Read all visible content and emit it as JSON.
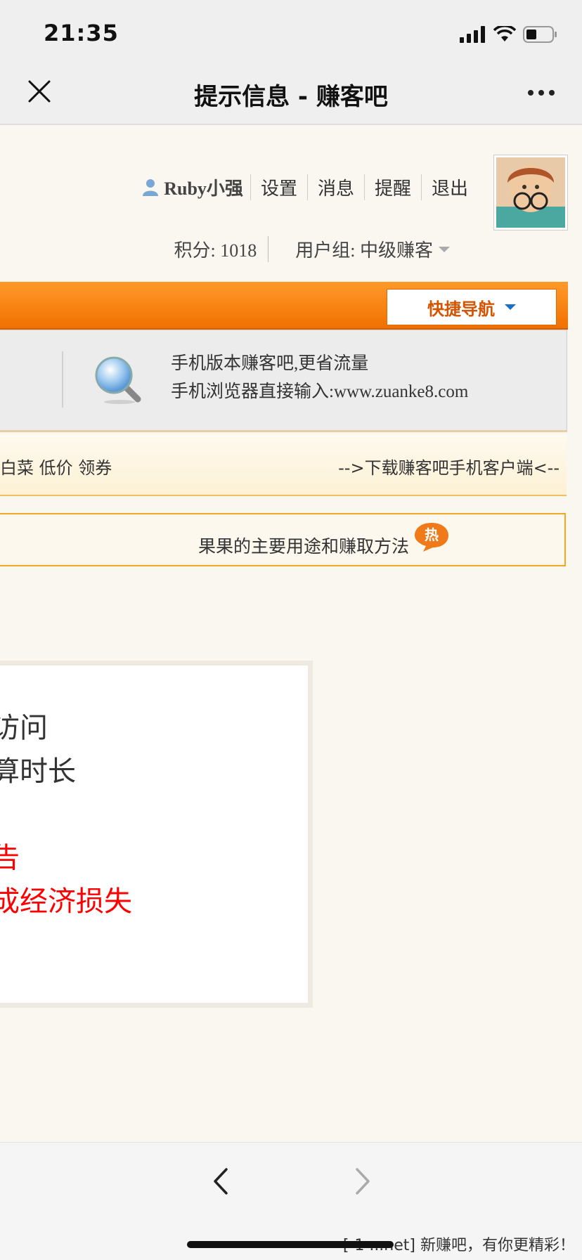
{
  "status_bar": {
    "time": "21:35"
  },
  "nav": {
    "title": "提示信息 - 赚客吧"
  },
  "user": {
    "name": "Ruby小强",
    "links": [
      "设置",
      "消息",
      "提醒",
      "退出"
    ],
    "points_text": "积分: 1018",
    "group_text": "用户组: 中级赚客"
  },
  "toolbar": {
    "quick_nav_label": "快捷导航"
  },
  "mobile_banner": {
    "line1": "手机版本赚客吧,更省流量",
    "line2": "手机浏览器直接输入:www.zuanke8.com"
  },
  "ticker": {
    "left_text": "白菜 低价 领券",
    "right_text": "-->下载赚客吧手机客户端<--"
  },
  "hot": {
    "text": "果果的主要用途和赚取方法",
    "badge": "热"
  },
  "message": {
    "line1": "访问",
    "line2": "算时长",
    "line3": "告",
    "line4": "成经济损失"
  },
  "watermark": "[-1 ...net] 新赚吧，有你更精彩！",
  "colors": {
    "accent_orange": "#f07000",
    "warning_red": "#ff0000"
  }
}
